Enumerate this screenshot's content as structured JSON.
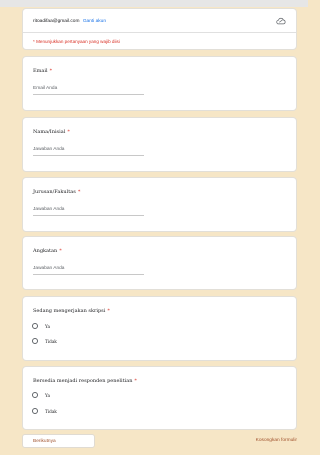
{
  "account": {
    "email": "ritoadifaa@gmail.com",
    "switch_label": "Ganti akun",
    "cloud_icon": "cloud-icon"
  },
  "required_note": "* Menunjukkan pertanyaan yang wajib diisi",
  "questions": [
    {
      "title": "Email",
      "required_mark": "*",
      "placeholder": "Email Anda"
    },
    {
      "title": "Nama/Inisial",
      "required_mark": "*",
      "placeholder": "Jawaban Anda"
    },
    {
      "title": "Jurusan/Fakultas",
      "required_mark": "*",
      "placeholder": "Jawaban Anda"
    },
    {
      "title": "Angkatan",
      "required_mark": "*",
      "placeholder": "Jawaban Anda"
    },
    {
      "title": "Sedang mengerjakan skripsi",
      "required_mark": "*",
      "options": [
        "Ya",
        "Tidak"
      ]
    },
    {
      "title": "Bersedia menjadi responden penelitian",
      "required_mark": "*",
      "options": [
        "Ya",
        "Tidak"
      ]
    }
  ],
  "footer": {
    "next_label": "Berikutnya",
    "clear_label": "Kosongkan formulir"
  },
  "colors": {
    "background": "#f6e6c6",
    "required": "#d93025",
    "link": "#1a73e8",
    "accent": "#a0522d"
  }
}
